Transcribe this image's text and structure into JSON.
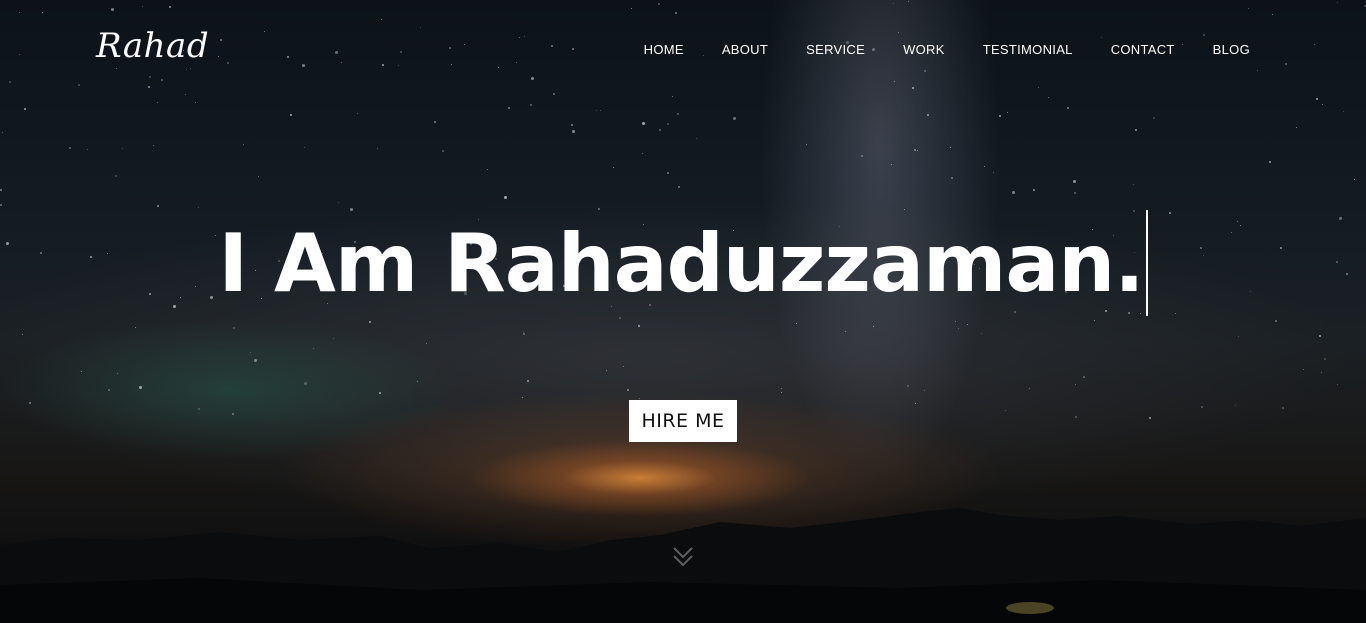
{
  "brand": {
    "logo_text": "Rahad"
  },
  "nav": {
    "items": [
      {
        "label": "HOME"
      },
      {
        "label": "ABOUT"
      },
      {
        "label": "SERVICE"
      },
      {
        "label": "WORK"
      },
      {
        "label": "TESTIMONIAL"
      },
      {
        "label": "CONTACT"
      },
      {
        "label": "BLOG"
      }
    ]
  },
  "hero": {
    "headline": "I Am Rahaduzzaman.",
    "cta_label": "HIRE ME",
    "scroll_icon": "double-chevron-down-icon"
  },
  "colors": {
    "text": "#ffffff",
    "button_bg": "#ffffff",
    "button_text": "#111111",
    "sky_dark": "#0c1218",
    "glow": "#ec923c"
  }
}
